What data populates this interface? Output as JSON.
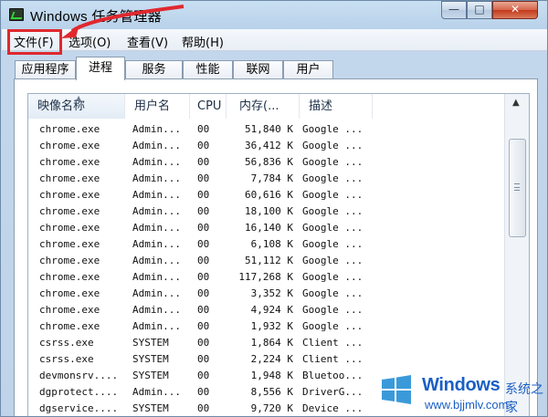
{
  "window": {
    "title": "Windows 任务管理器",
    "controls": {
      "minimize": "—",
      "maximize": "□",
      "close": "✕"
    }
  },
  "menu": [
    {
      "label": "文件(F)"
    },
    {
      "label": "选项(O)"
    },
    {
      "label": "查看(V)"
    },
    {
      "label": "帮助(H)"
    }
  ],
  "tabs": [
    {
      "label": "应用程序"
    },
    {
      "label": "进程",
      "selected": true
    },
    {
      "label": "服务"
    },
    {
      "label": "性能"
    },
    {
      "label": "联网"
    },
    {
      "label": "用户"
    }
  ],
  "process_list": {
    "columns": [
      "映像名称",
      "用户名",
      "CPU",
      "内存(...",
      "描述"
    ],
    "rows": [
      {
        "name": "chrome.exe",
        "user": "Admin...",
        "cpu": "00",
        "mem": "51,840 K",
        "desc": "Google ..."
      },
      {
        "name": "chrome.exe",
        "user": "Admin...",
        "cpu": "00",
        "mem": "36,412 K",
        "desc": "Google ..."
      },
      {
        "name": "chrome.exe",
        "user": "Admin...",
        "cpu": "00",
        "mem": "56,836 K",
        "desc": "Google ..."
      },
      {
        "name": "chrome.exe",
        "user": "Admin...",
        "cpu": "00",
        "mem": "7,784 K",
        "desc": "Google ..."
      },
      {
        "name": "chrome.exe",
        "user": "Admin...",
        "cpu": "00",
        "mem": "60,616 K",
        "desc": "Google ..."
      },
      {
        "name": "chrome.exe",
        "user": "Admin...",
        "cpu": "00",
        "mem": "18,100 K",
        "desc": "Google ..."
      },
      {
        "name": "chrome.exe",
        "user": "Admin...",
        "cpu": "00",
        "mem": "16,140 K",
        "desc": "Google ..."
      },
      {
        "name": "chrome.exe",
        "user": "Admin...",
        "cpu": "00",
        "mem": "6,108 K",
        "desc": "Google ..."
      },
      {
        "name": "chrome.exe",
        "user": "Admin...",
        "cpu": "00",
        "mem": "51,112 K",
        "desc": "Google ..."
      },
      {
        "name": "chrome.exe",
        "user": "Admin...",
        "cpu": "00",
        "mem": "117,268 K",
        "desc": "Google ..."
      },
      {
        "name": "chrome.exe",
        "user": "Admin...",
        "cpu": "00",
        "mem": "3,352 K",
        "desc": "Google ..."
      },
      {
        "name": "chrome.exe",
        "user": "Admin...",
        "cpu": "00",
        "mem": "4,924 K",
        "desc": "Google ..."
      },
      {
        "name": "chrome.exe",
        "user": "Admin...",
        "cpu": "00",
        "mem": "1,932 K",
        "desc": "Google ..."
      },
      {
        "name": "csrss.exe",
        "user": "SYSTEM",
        "cpu": "00",
        "mem": "1,864 K",
        "desc": "Client ..."
      },
      {
        "name": "csrss.exe",
        "user": "SYSTEM",
        "cpu": "00",
        "mem": "2,224 K",
        "desc": "Client ..."
      },
      {
        "name": "devmonsrv....",
        "user": "SYSTEM",
        "cpu": "00",
        "mem": "1,948 K",
        "desc": "Bluetoo..."
      },
      {
        "name": "dgprotect....",
        "user": "Admin...",
        "cpu": "00",
        "mem": "8,556 K",
        "desc": "DriverG..."
      },
      {
        "name": "dgservice....",
        "user": "SYSTEM",
        "cpu": "00",
        "mem": "9,720 K",
        "desc": "Device ..."
      }
    ]
  },
  "scrollbar": {
    "up_arrow": "▲",
    "grip": "≡"
  },
  "watermark": {
    "brand": "Windows",
    "cn": "系统之家",
    "url": "www.bjjmlv.com"
  },
  "colors": {
    "annotation_red": "#e0282e",
    "frame_blue": "#bfd3e9",
    "watermark_blue": "#1b5fc4"
  }
}
